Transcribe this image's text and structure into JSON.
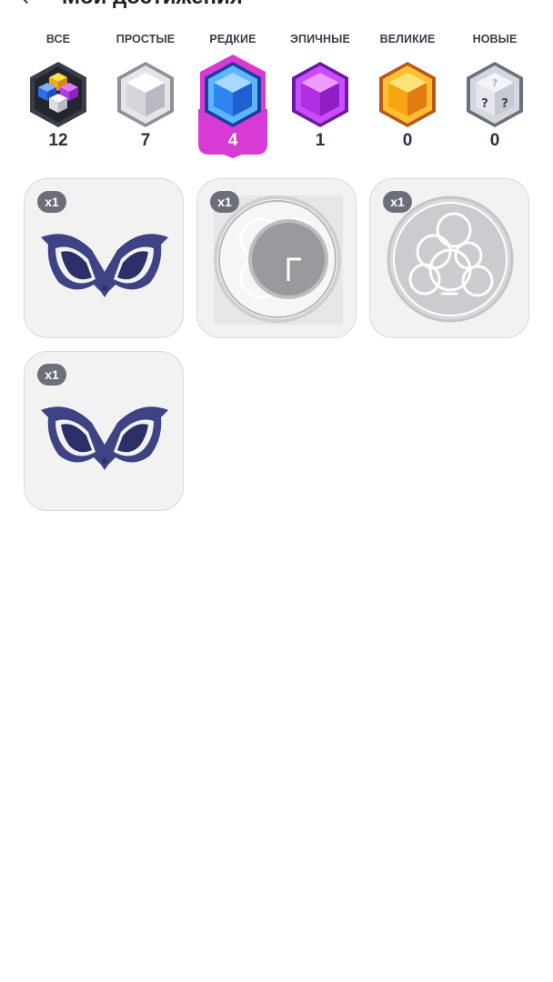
{
  "header": {
    "back_icon": "chevron-left-icon",
    "title": "Мои достижения"
  },
  "tabs": [
    {
      "label": "ВСЕ",
      "count": "12",
      "icon": "multicolor-cubes-icon"
    },
    {
      "label": "ПРОСТЫЕ",
      "count": "7",
      "icon": "gray-cube-icon"
    },
    {
      "label": "РЕДКИЕ",
      "count": "4",
      "icon": "blue-cube-icon",
      "active": true
    },
    {
      "label": "ЭПИЧНЫЕ",
      "count": "1",
      "icon": "purple-cube-icon"
    },
    {
      "label": "ВЕЛИКИЕ",
      "count": "0",
      "icon": "gold-cube-icon"
    },
    {
      "label": "НОВЫЕ",
      "count": "0",
      "icon": "mystery-cube-icon"
    }
  ],
  "achievements": [
    {
      "badge": "x1",
      "icon": "mask-icon"
    },
    {
      "badge": "x1",
      "icon": "clock-icon"
    },
    {
      "badge": "x1",
      "icon": "circles-emblem-icon"
    },
    {
      "badge": "x1",
      "icon": "mask-icon"
    }
  ],
  "colors": {
    "accent": "#d83ad6",
    "tab_text": "#3a3e4a",
    "card_bg": "#f2f2f3"
  }
}
